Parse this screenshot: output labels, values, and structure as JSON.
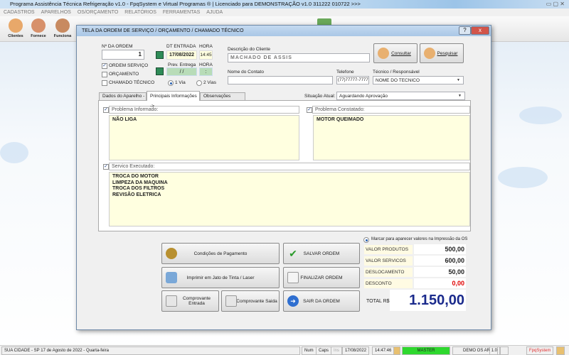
{
  "app": {
    "title": "Programa Assistência Técnica Refrigeração v1.0 - FpqSystem e Virtual Programas ® | Licenciado para  DEMONSTRAÇÃO v1.0 311222 010722 >>>"
  },
  "menu": [
    "CADASTROS",
    "APARELHOS",
    "OS/ORÇAMENTO",
    "RELATÓRIOS",
    "FERRAMENTAS",
    "AJUDA"
  ],
  "toolbar": [
    "Clientes",
    "Fornece",
    "Funciona"
  ],
  "dialog": {
    "title": "TELA DA ORDEM DE SERVIÇO / ORÇAMENTO / CHAMADO TÉCNICO",
    "help": "?",
    "close": "x",
    "order_label": "Nº DA ORDEM",
    "order_value": "1",
    "types": [
      {
        "label": "ORDEM SERVIÇO",
        "checked": true
      },
      {
        "label": "ORÇAMENTO",
        "checked": false
      },
      {
        "label": "CHAMADO TÉCNICO",
        "checked": false
      }
    ],
    "dt_entrada_label": "DT ENTRADA",
    "dt_entrada": "17/08/2022",
    "hora_label": "HORA",
    "hora": "14:45",
    "prev_label": "Prev. Entrega",
    "prev_value": " / /",
    "prev_hora": ":",
    "vias": [
      {
        "label": "1 Via",
        "checked": true
      },
      {
        "label": "2 Vias",
        "checked": false
      }
    ],
    "cliente_label": "Descrição do Cliente",
    "cliente": "MACHADO DE ASSIS",
    "consultar": "Consultar",
    "pesquisar": "Pesquisar",
    "contato_label": "Nome do Contato",
    "contato": "",
    "telefone_label": "Telefone",
    "telefone": "(77)77777-7777",
    "tecnico_label": "Técnico / Responsável",
    "tecnico": "NOME DO TECNICO",
    "tabs": [
      "Dados do Aparelho ->",
      "Principais Informações ->",
      "Observações Gerais"
    ],
    "situacao_label": "Situação Atual:",
    "situacao": "Aguardando Aprovação",
    "problema_informado_label": "Problema Informado:",
    "problema_informado": "NÃO LIGA",
    "problema_constatado_label": "Problema Constatado:",
    "problema_constatado": "MOTOR QUEIMADO",
    "servico_label": "Servico Executado:",
    "servico": "TROCA DO MOTOR\nLIMPEZA DA MAQUINA\nTROCA DOS FILTROS\nREVISÃO ELETRICA",
    "buttons": {
      "pagamento": "Condições de Pagamento",
      "imprimir": "Imprimir em Jato de Tinta / Laser",
      "comp_entrada": "Comprovante Entrada",
      "comp_saida": "Comprovante Saida",
      "salvar": "SALVAR ORDEM",
      "finalizar": "FINALIZAR ORDEM",
      "sair": "SAIR DA ORDEM"
    },
    "marcar_label": "Marcar para aparecer valores na Impressão da OS",
    "values": [
      {
        "label": "VALOR PRODUTOS",
        "value": "500,00"
      },
      {
        "label": "VALOR SERVICOS",
        "value": "600,00"
      },
      {
        "label": "DESLOCAMENTO",
        "value": "50,00"
      },
      {
        "label": "DESCONTO",
        "value": "0,00"
      }
    ],
    "total_label": "TOTAL R$",
    "total": "1.150,00"
  },
  "status": {
    "city": "SUA CIDADE - SP 17 de Agosto de 2022 - Quarta-feira",
    "num": "Num",
    "caps": "Caps",
    "ins": "Ins",
    "date": "17/08/2022",
    "time": "14:47:46",
    "user": "MASTER",
    "version": "DEMO OS AR 1.0",
    "brand": "FpqSystem"
  },
  "colors": {
    "total": "#1a2a8c",
    "desconto": "#e00000",
    "master": "#2ed82e",
    "field_yellow": "#ffffe0"
  }
}
